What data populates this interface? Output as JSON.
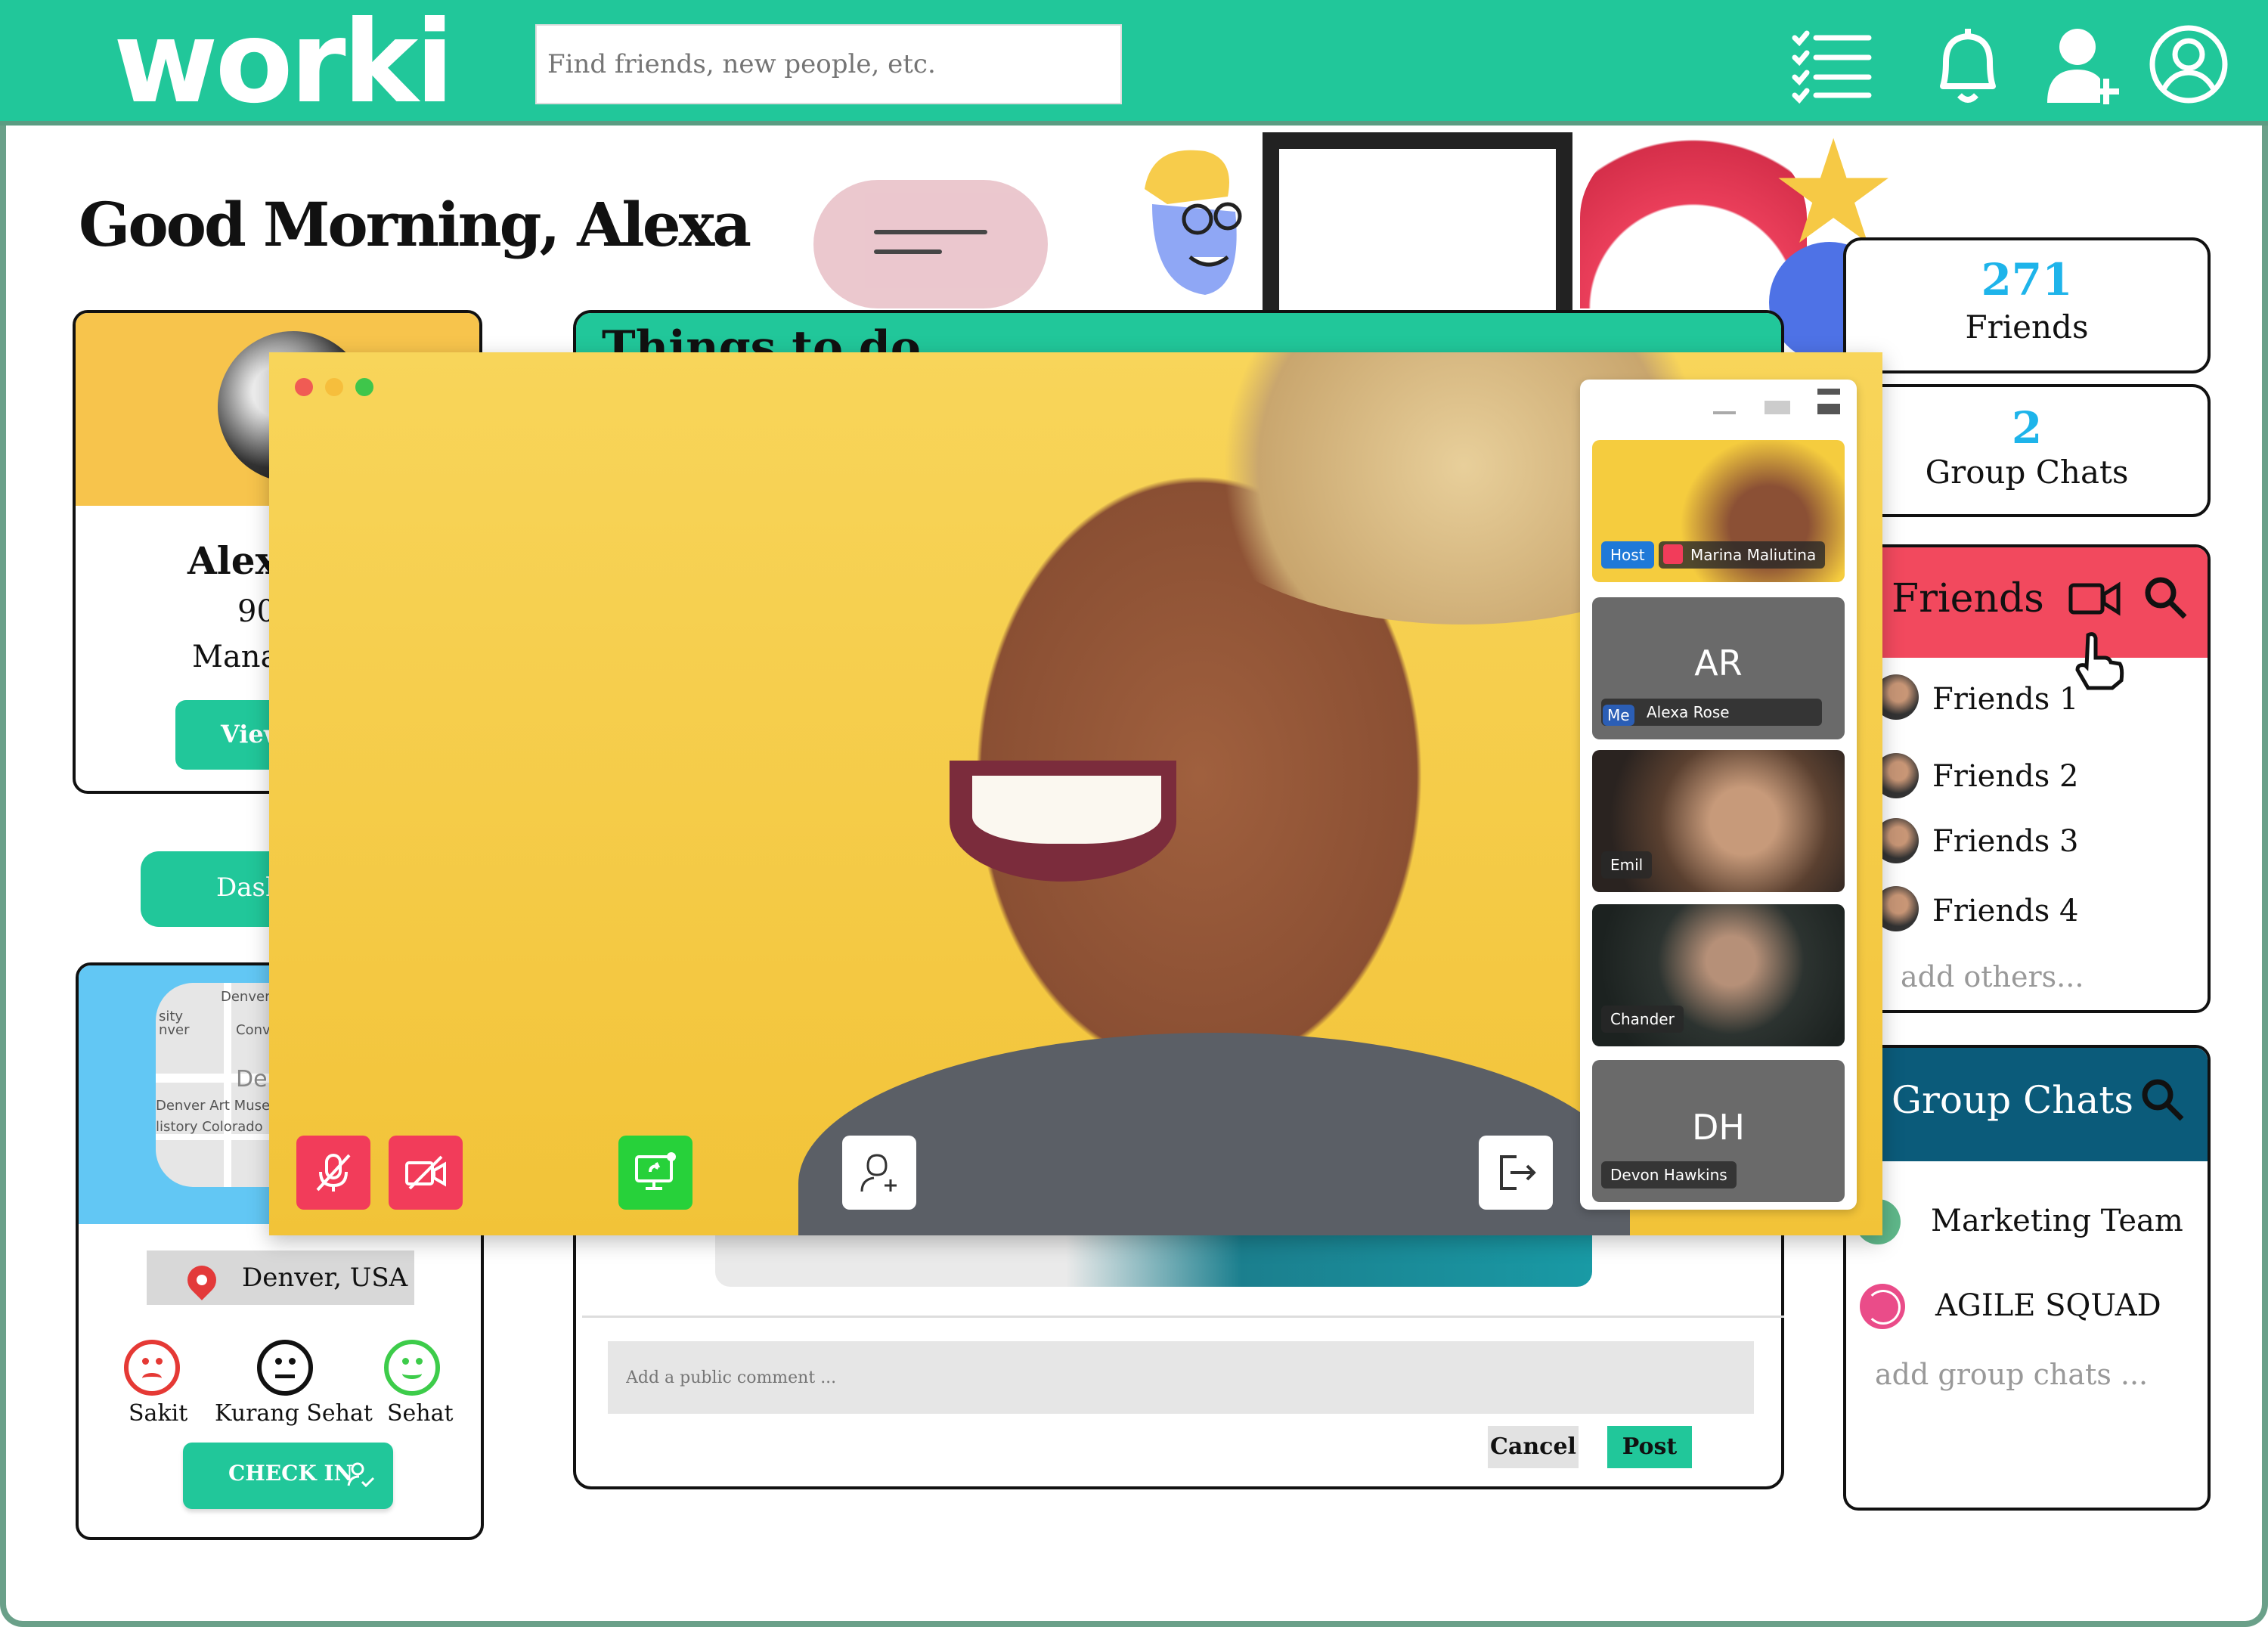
{
  "header": {
    "logo": "worki",
    "search_placeholder": "Find friends, new people, etc.",
    "icons": [
      "checklist-icon",
      "bell-icon",
      "add-user-icon",
      "user-profile-icon"
    ]
  },
  "greeting": "Good Morning, Alexa",
  "profile": {
    "name": "Alexa",
    "number": "90",
    "role": "Manag",
    "view_label": "View"
  },
  "dashboard_label": "Dash",
  "location": {
    "map_labels": [
      "Denver,",
      "sity",
      "nver",
      "Conv",
      "De",
      "Denver Art Museu",
      "listory Colorado"
    ],
    "city": "Denver, USA",
    "moods": [
      {
        "label": "Sakit",
        "color": "#e53935"
      },
      {
        "label": "Kurang Sehat",
        "color": "#111111"
      },
      {
        "label": "Sehat",
        "color": "#3dcc4a"
      }
    ],
    "checkin_label": "CHECK IN"
  },
  "todo": {
    "title": "Things to do",
    "comment_placeholder": "Add a public comment ...",
    "cancel_label": "Cancel",
    "post_label": "Post"
  },
  "stats": {
    "friends_count": "271",
    "friends_label": "Friends",
    "groups_count": "2",
    "groups_label": "Group Chats"
  },
  "friends": {
    "title": "Friends",
    "items": [
      "Friends 1",
      "Friends 2",
      "Friends 3",
      "Friends 4"
    ],
    "add_more": "add others..."
  },
  "groups": {
    "title": "Group Chats",
    "items": [
      "Marketing Team",
      "AGILE SQUAD"
    ],
    "add_more": "add group chats ..."
  },
  "video_call": {
    "participants": [
      {
        "name": "Marina Maliutina",
        "badge": "Host"
      },
      {
        "name": "Alexa Rose",
        "initials": "AR",
        "badge": "Me"
      },
      {
        "name": "Emil"
      },
      {
        "name": "Chander"
      },
      {
        "name": "Devon Hawkins",
        "initials": "DH"
      }
    ],
    "colors": {
      "mute": "#f23c5a",
      "share": "#27d13a",
      "bg": "#f5cc3e"
    }
  }
}
